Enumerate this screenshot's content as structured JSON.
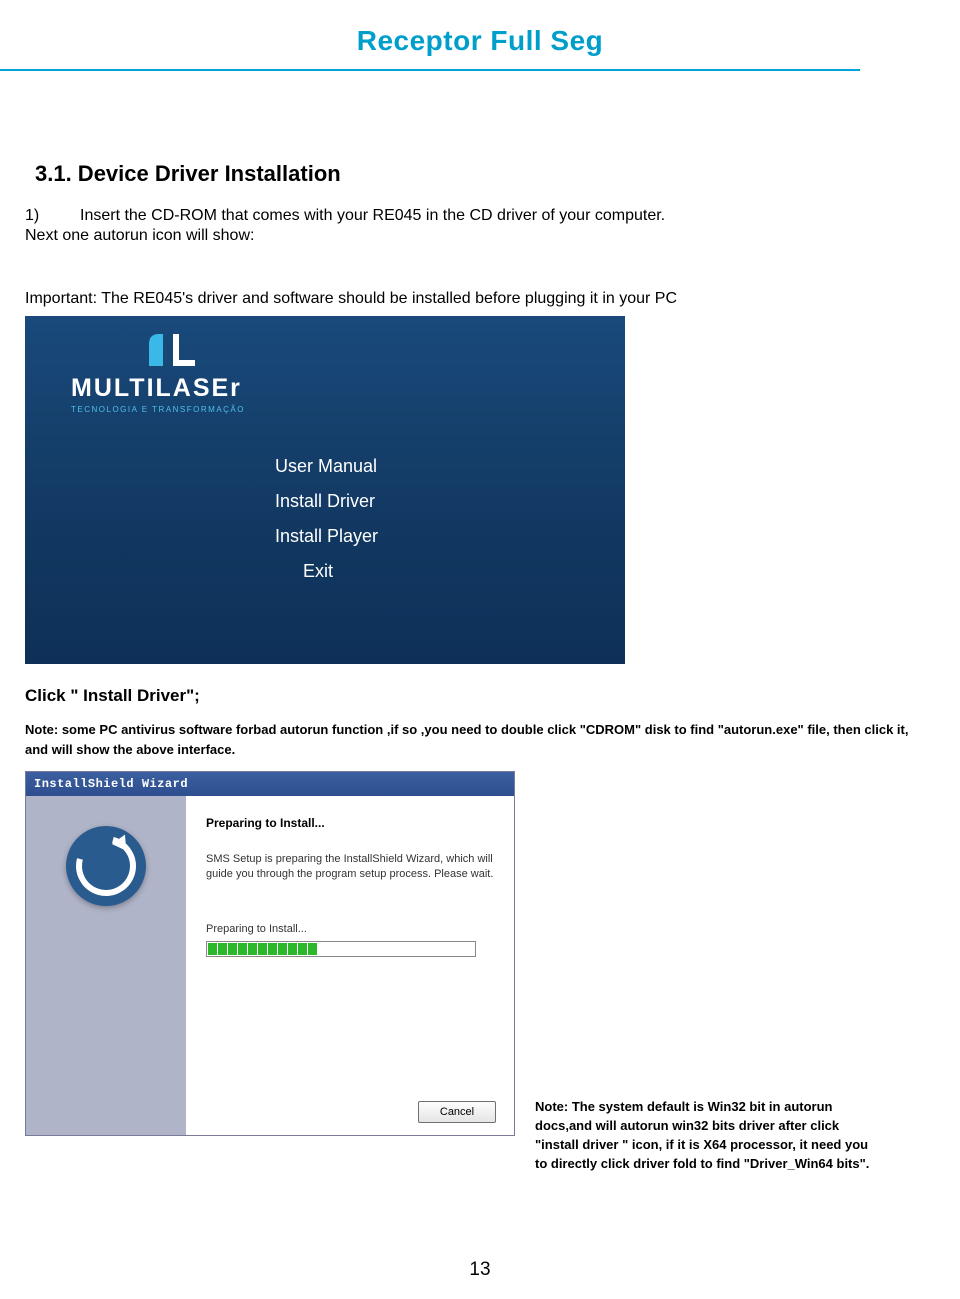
{
  "header": {
    "title": "Receptor Full Seg"
  },
  "section": {
    "heading": "3.1. Device Driver Installation",
    "step_num": "1)",
    "step_text": "Insert the CD-ROM that comes with your RE045 in the CD driver of your computer.",
    "next_line": "Next one autorun icon will show:",
    "important": "Important: The RE045's driver and software should be installed before plugging it in your PC"
  },
  "autorun": {
    "logo_text": "MULTILASEr",
    "logo_sub": "TECNOLOGIA E TRANSFORMAÇÃO",
    "menu": {
      "user_manual": "User Manual",
      "install_driver": "Install Driver",
      "install_player": "Install Player",
      "exit": "Exit"
    }
  },
  "click_line": "Click \" Install Driver\";",
  "note1": "Note: some PC antivirus software forbad autorun function ,if so ,you need to double click \"CDROM\" disk to find \"autorun.exe\" file, then click it, and will show the above interface.",
  "installer": {
    "title": "InstallShield Wizard",
    "heading": "Preparing to Install...",
    "body": "SMS Setup is preparing the InstallShield Wizard, which will guide you through the program setup process.  Please wait.",
    "sub": "Preparing to Install...",
    "cancel": "Cancel"
  },
  "side_note": "Note: The system default is Win32 bit in autorun docs,and will autorun win32 bits driver after click \"install driver \" icon,  if it is X64 processor, it need you to directly click driver fold to find \"Driver_Win64 bits\".",
  "page_number": "13"
}
